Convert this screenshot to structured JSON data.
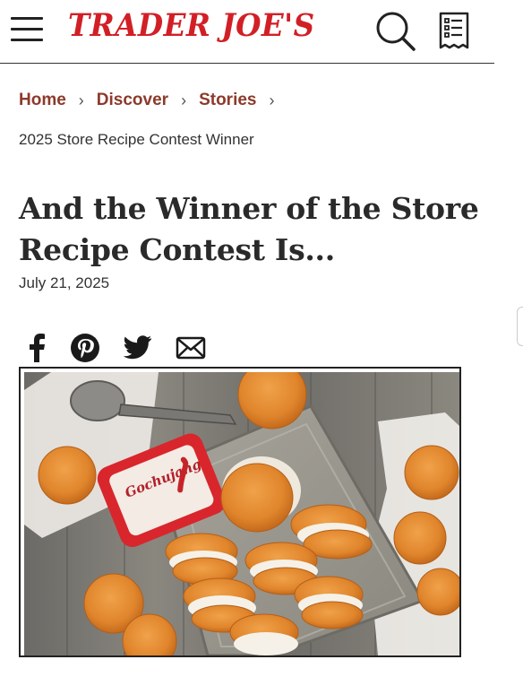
{
  "header": {
    "logo_text": "TRADER JOE'S",
    "brand_color": "#d21f26",
    "icons": [
      "menu-icon",
      "search-icon",
      "shopping-list-icon"
    ]
  },
  "breadcrumb": {
    "items": [
      "Home",
      "Discover",
      "Stories"
    ],
    "current": "2025 Store Recipe Contest Winner",
    "link_color": "#8c3a2b"
  },
  "article": {
    "title": "And the Winner of the Store Recipe Contest Is...",
    "date": "July 21, 2025"
  },
  "share_icons": [
    "facebook-icon",
    "pinterest-icon",
    "twitter-icon",
    "email-icon"
  ],
  "hero_image": {
    "description_type": "photo",
    "tub_label": "Gochujang"
  }
}
